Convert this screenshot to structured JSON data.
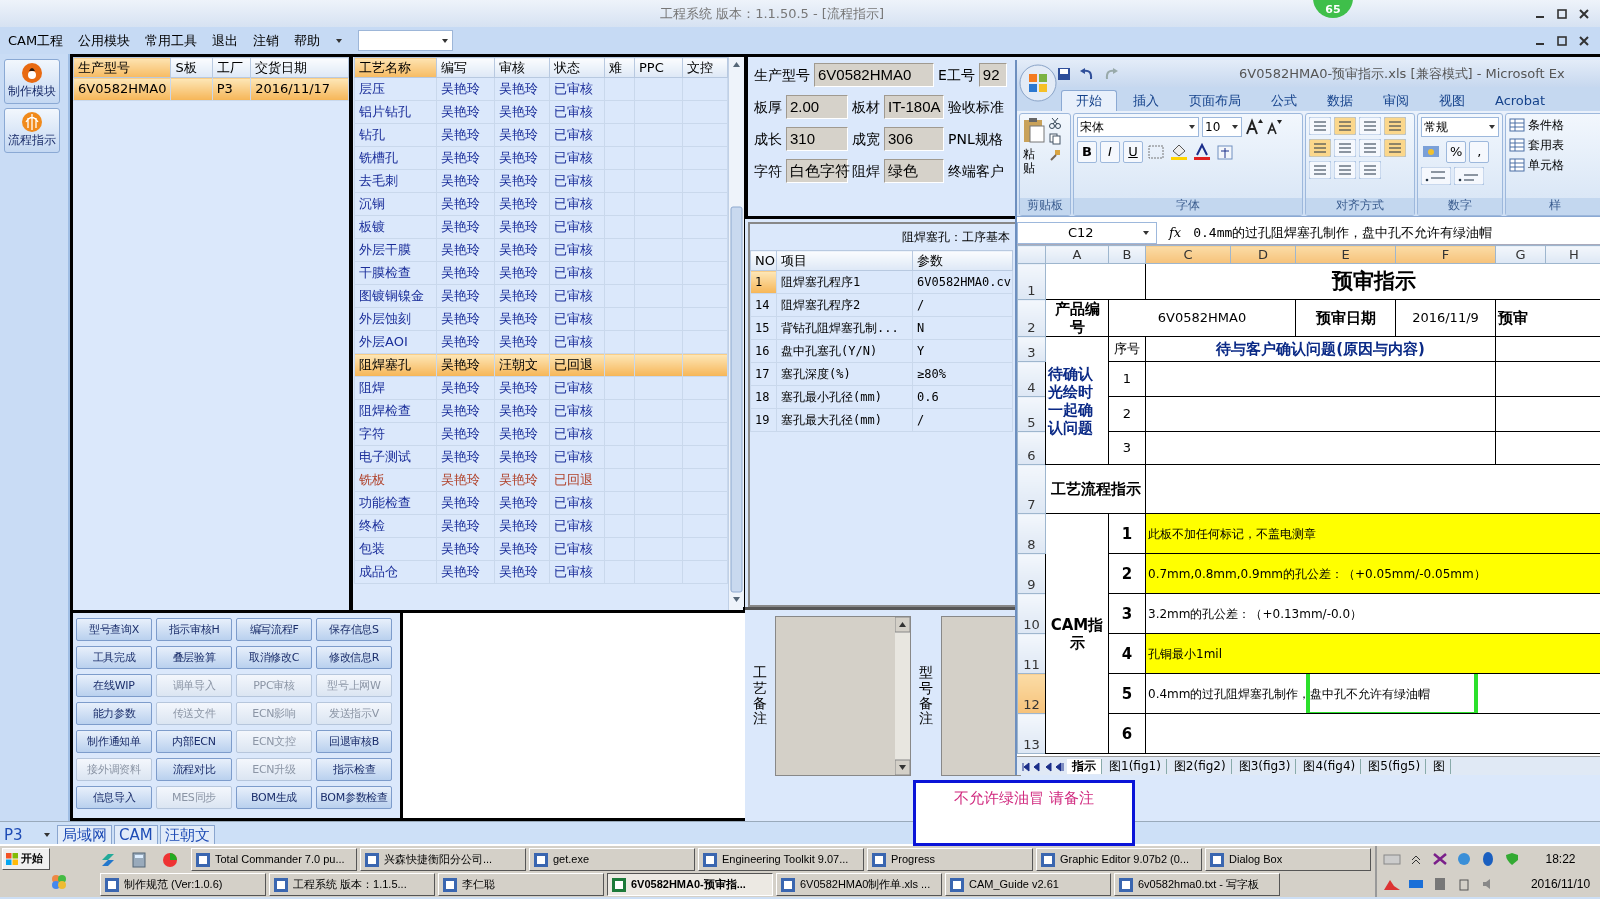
{
  "window": {
    "title": "工程系统   版本：1.1.50.5 - [流程指示]",
    "badge": "65"
  },
  "menu": [
    "CAM工程",
    "公用模块",
    "常用工具",
    "退出",
    "注销",
    "帮助"
  ],
  "sidebar": [
    {
      "label": "制作模块"
    },
    {
      "label": "流程指示"
    }
  ],
  "orders": {
    "columns": [
      "生产型号",
      "S板",
      "工厂",
      "交货日期"
    ],
    "rows": [
      {
        "model": "6V0582HMA0",
        "factory": "P3",
        "due": "2016/11/17",
        "selected": true
      }
    ]
  },
  "processes": {
    "columns": [
      "工艺名称",
      "编写",
      "审核",
      "状态",
      "难",
      "PPC",
      "文控"
    ],
    "rows": [
      {
        "name": "层压",
        "writer": "吴艳玲",
        "reviewer": "吴艳玲",
        "status": "已审核",
        "selected": false,
        "flagged": false
      },
      {
        "name": "铝片钻孔",
        "writer": "吴艳玲",
        "reviewer": "吴艳玲",
        "status": "已审核",
        "selected": false,
        "flagged": false
      },
      {
        "name": "钻孔",
        "writer": "吴艳玲",
        "reviewer": "吴艳玲",
        "status": "已审核",
        "selected": false,
        "flagged": false
      },
      {
        "name": "铣槽孔",
        "writer": "吴艳玲",
        "reviewer": "吴艳玲",
        "status": "已审核",
        "selected": false,
        "flagged": false
      },
      {
        "name": "去毛刺",
        "writer": "吴艳玲",
        "reviewer": "吴艳玲",
        "status": "已审核",
        "selected": false,
        "flagged": false
      },
      {
        "name": "沉铜",
        "writer": "吴艳玲",
        "reviewer": "吴艳玲",
        "status": "已审核",
        "selected": false,
        "flagged": false
      },
      {
        "name": "板镀",
        "writer": "吴艳玲",
        "reviewer": "吴艳玲",
        "status": "已审核",
        "selected": false,
        "flagged": false
      },
      {
        "name": "外层干膜",
        "writer": "吴艳玲",
        "reviewer": "吴艳玲",
        "status": "已审核",
        "selected": false,
        "flagged": false
      },
      {
        "name": "干膜检查",
        "writer": "吴艳玲",
        "reviewer": "吴艳玲",
        "status": "已审核",
        "selected": false,
        "flagged": false
      },
      {
        "name": "图镀铜镍金",
        "writer": "吴艳玲",
        "reviewer": "吴艳玲",
        "status": "已审核",
        "selected": false,
        "flagged": false
      },
      {
        "name": "外层蚀刻",
        "writer": "吴艳玲",
        "reviewer": "吴艳玲",
        "status": "已审核",
        "selected": false,
        "flagged": false
      },
      {
        "name": "外层AOI",
        "writer": "吴艳玲",
        "reviewer": "吴艳玲",
        "status": "已审核",
        "selected": false,
        "flagged": false
      },
      {
        "name": "阻焊塞孔",
        "writer": "吴艳玲",
        "reviewer": "汪朝文",
        "status": "已回退",
        "selected": true,
        "flagged": false
      },
      {
        "name": "阻焊",
        "writer": "吴艳玲",
        "reviewer": "吴艳玲",
        "status": "已审核",
        "selected": false,
        "flagged": false
      },
      {
        "name": "阻焊检查",
        "writer": "吴艳玲",
        "reviewer": "吴艳玲",
        "status": "已审核",
        "selected": false,
        "flagged": false
      },
      {
        "name": "字符",
        "writer": "吴艳玲",
        "reviewer": "吴艳玲",
        "status": "已审核",
        "selected": false,
        "flagged": false
      },
      {
        "name": "电子测试",
        "writer": "吴艳玲",
        "reviewer": "吴艳玲",
        "status": "已审核",
        "selected": false,
        "flagged": false
      },
      {
        "name": "铣板",
        "writer": "吴艳玲",
        "reviewer": "吴艳玲",
        "status": "已回退",
        "selected": false,
        "flagged": true
      },
      {
        "name": "功能检查",
        "writer": "吴艳玲",
        "reviewer": "吴艳玲",
        "status": "已审核",
        "selected": false,
        "flagged": false
      },
      {
        "name": "终检",
        "writer": "吴艳玲",
        "reviewer": "吴艳玲",
        "status": "已审核",
        "selected": false,
        "flagged": false
      },
      {
        "name": "包装",
        "writer": "吴艳玲",
        "reviewer": "吴艳玲",
        "status": "已审核",
        "selected": false,
        "flagged": false
      },
      {
        "name": "成品仓",
        "writer": "吴艳玲",
        "reviewer": "吴艳玲",
        "status": "已审核",
        "selected": false,
        "flagged": false
      }
    ]
  },
  "actions": [
    {
      "label": "型号查询X",
      "disabled": false
    },
    {
      "label": "指示审核H",
      "disabled": false
    },
    {
      "label": "编写流程F",
      "disabled": false
    },
    {
      "label": "保存信息S",
      "disabled": false
    },
    {
      "label": "工具完成",
      "disabled": false
    },
    {
      "label": "叠层验算",
      "disabled": false
    },
    {
      "label": "取消修改C",
      "disabled": false
    },
    {
      "label": "修改信息R",
      "disabled": false
    },
    {
      "label": "在线WIP",
      "disabled": false
    },
    {
      "label": "调单导入",
      "disabled": true
    },
    {
      "label": "PPC审核",
      "disabled": true
    },
    {
      "label": "型号上网W",
      "disabled": true
    },
    {
      "label": "能力参数",
      "disabled": false
    },
    {
      "label": "传送文件",
      "disabled": true
    },
    {
      "label": "ECN影响",
      "disabled": true
    },
    {
      "label": "发送指示V",
      "disabled": true
    },
    {
      "label": "制作通知单",
      "disabled": false
    },
    {
      "label": "内部ECN",
      "disabled": false
    },
    {
      "label": "ECN文控",
      "disabled": true
    },
    {
      "label": "回退审核B",
      "disabled": false
    },
    {
      "label": "接外调资料",
      "disabled": true
    },
    {
      "label": "流程对比",
      "disabled": false
    },
    {
      "label": "ECN升级",
      "disabled": true
    },
    {
      "label": "指示检查",
      "disabled": false
    },
    {
      "label": "信息导入",
      "disabled": false
    },
    {
      "label": "MES同步",
      "disabled": true
    },
    {
      "label": "BOM生成",
      "disabled": false
    },
    {
      "label": "BOM参数检查",
      "disabled": false
    }
  ],
  "product": {
    "fields": [
      [
        {
          "label": "生产型号",
          "value": "6V0582HMA0"
        },
        {
          "label": "E工号",
          "value": "92"
        }
      ],
      [
        {
          "label": "板厚",
          "value": "2.00"
        },
        {
          "label": "板材",
          "value": "IT-180A"
        },
        {
          "label": "验收标准"
        }
      ],
      [
        {
          "label": "成长",
          "value": "310"
        },
        {
          "label": "成宽",
          "value": "306"
        },
        {
          "label": "PNL规格"
        }
      ],
      [
        {
          "label": "字符",
          "value": "白色字符"
        },
        {
          "label": "阻焊",
          "value": "绿色"
        },
        {
          "label": "终端客户"
        }
      ]
    ]
  },
  "parameters": {
    "title": "阻焊塞孔：工序基本",
    "columns": [
      "NO",
      "项目",
      "参数"
    ],
    "rows": [
      {
        "no": "1",
        "item": "阻焊塞孔程序1",
        "value": "6V0582HMA0.cv",
        "selected": true
      },
      {
        "no": "14",
        "item": "阻焊塞孔程序2",
        "value": "/",
        "selected": false
      },
      {
        "no": "15",
        "item": "背钻孔阻焊塞孔制...",
        "value": "N",
        "selected": false
      },
      {
        "no": "16",
        "item": "盘中孔塞孔(Y/N)",
        "value": "Y",
        "selected": false
      },
      {
        "no": "17",
        "item": "塞孔深度(%)",
        "value": "≥80%",
        "selected": false
      },
      {
        "no": "18",
        "item": "塞孔最小孔径(mm)",
        "value": "0.6",
        "selected": false
      },
      {
        "no": "19",
        "item": "塞孔最大孔径(mm)",
        "value": "/",
        "selected": false
      }
    ]
  },
  "remarks": [
    {
      "label": "工艺备注"
    },
    {
      "label": "型号备注"
    }
  ],
  "excel": {
    "title": "6V0582HMA0-预审指示.xls  [兼容模式] - Microsoft Ex",
    "tabs": [
      {
        "label": "开始",
        "selected": true
      },
      {
        "label": "插入",
        "selected": false
      },
      {
        "label": "页面布局",
        "selected": false
      },
      {
        "label": "公式",
        "selected": false
      },
      {
        "label": "数据",
        "selected": false
      },
      {
        "label": "审阅",
        "selected": false
      },
      {
        "label": "视图",
        "selected": false
      },
      {
        "label": "Acrobat",
        "selected": false
      }
    ],
    "ribbon": {
      "groups": [
        "剪贴板",
        "字体",
        "对齐方式",
        "数字",
        "样"
      ],
      "paste": "粘贴",
      "font": "宋体",
      "size": "10",
      "font_buttons": [
        "B",
        "I",
        "U"
      ],
      "number_format": "常规",
      "number_buttons": [
        "%",
        ","
      ],
      "styles": [
        "条件格",
        "套用表",
        "单元格"
      ]
    },
    "name_box": "C12",
    "function_label": "fx",
    "formula": "0.4mm的过孔阻焊塞孔制作，盘中孔不允许有绿油帽",
    "columns": [
      {
        "label": "A",
        "selected": false
      },
      {
        "label": "B",
        "selected": false
      },
      {
        "label": "C",
        "selected": true
      },
      {
        "label": "D",
        "selected": true
      },
      {
        "label": "E",
        "selected": true
      },
      {
        "label": "F",
        "selected": true
      },
      {
        "label": "G",
        "selected": false
      },
      {
        "label": "H",
        "selected": false
      }
    ],
    "rows": [
      {
        "label": "1",
        "selected": false
      },
      {
        "label": "2",
        "selected": false
      },
      {
        "label": "3",
        "selected": false
      },
      {
        "label": "4",
        "selected": false
      },
      {
        "label": "5",
        "selected": false
      },
      {
        "label": "6",
        "selected": false
      },
      {
        "label": "7",
        "selected": false
      },
      {
        "label": "8",
        "selected": false
      },
      {
        "label": "9",
        "selected": false
      },
      {
        "label": "10",
        "selected": false
      },
      {
        "label": "11",
        "selected": false
      },
      {
        "label": "12",
        "selected": true
      },
      {
        "label": "13",
        "selected": false
      }
    ],
    "sheet": {
      "title": "预审指示",
      "product_label": "产品编号",
      "product_value": "6V0582HMA0",
      "date_label": "预审日期",
      "date_value": "2016/11/9",
      "reviewer_label": "预审",
      "questions": {
        "label": "待确认光绘时一起确认问题",
        "number_header": "序号",
        "header": "待与客户确认问题(原因与内容)",
        "numbers": [
          "1",
          "2",
          "3"
        ]
      },
      "flow_label": "工艺流程指示",
      "cam": {
        "label": "CAM指示",
        "items": [
          {
            "number": "1",
            "text": "此板不加任何标记，不盖电测章",
            "highlight": true,
            "framed": false
          },
          {
            "number": "2",
            "text": "0.7mm,0.8mm,0.9mm的孔公差：（+0.05mm/-0.05mm）",
            "highlight": true,
            "framed": false
          },
          {
            "number": "3",
            "text": "3.2mm的孔公差：（+0.13mm/-0.0）",
            "highlight": false,
            "framed": false
          },
          {
            "number": "4",
            "text": "孔铜最小1mil",
            "highlight": true,
            "framed": false
          },
          {
            "number": "5",
            "text": "0.4mm的过孔阻焊塞孔制作，盘中孔不允许有绿油帽",
            "highlight": false,
            "framed": true
          },
          {
            "number": "6",
            "highlight": false,
            "framed": false
          }
        ]
      }
    },
    "sheet_tabs": [
      {
        "label": "指示",
        "selected": true
      },
      {
        "label": "图1(fig1)",
        "selected": false
      },
      {
        "label": "图2(fig2)",
        "selected": false
      },
      {
        "label": "图3(fig3)",
        "selected": false
      },
      {
        "label": "图4(fig4)",
        "selected": false
      },
      {
        "label": "图5(fig5)",
        "selected": false
      },
      {
        "label": "图",
        "selected": false
      }
    ]
  },
  "popup": {
    "text": "不允许绿油冒  请备注"
  },
  "bottom_tabs": {
    "combo": "P3",
    "tabs": [
      "局域网",
      "CAM",
      "汪朝文"
    ]
  },
  "taskbar": {
    "start": "开始",
    "row1": [
      {
        "label": "Total Commander 7.0 pu...",
        "selected": false
      },
      {
        "label": "兴森快捷衡阳分公司...",
        "selected": false
      },
      {
        "label": "get.exe",
        "selected": false
      },
      {
        "label": "Engineering Toolkit 9.07...",
        "selected": false
      },
      {
        "label": "Progress",
        "selected": false
      },
      {
        "label": "Graphic Editor 9.07b2 (0...",
        "selected": false
      },
      {
        "label": "Dialog Box",
        "selected": false
      }
    ],
    "row2": [
      {
        "label": "制作规范 (Ver:1.0.6)",
        "selected": false
      },
      {
        "label": "工程系统  版本：1.1.5...",
        "selected": false
      },
      {
        "label": "李仁聪",
        "selected": false
      },
      {
        "label": "6V0582HMA0-预审指...",
        "selected": true
      },
      {
        "label": "6V0582HMA0制作单.xls ...",
        "selected": false
      },
      {
        "label": "CAM_Guide v2.61",
        "selected": false
      },
      {
        "label": "6v0582hma0.txt - 写字板",
        "selected": false
      }
    ],
    "time": "18:22",
    "date": "2016/11/10"
  }
}
